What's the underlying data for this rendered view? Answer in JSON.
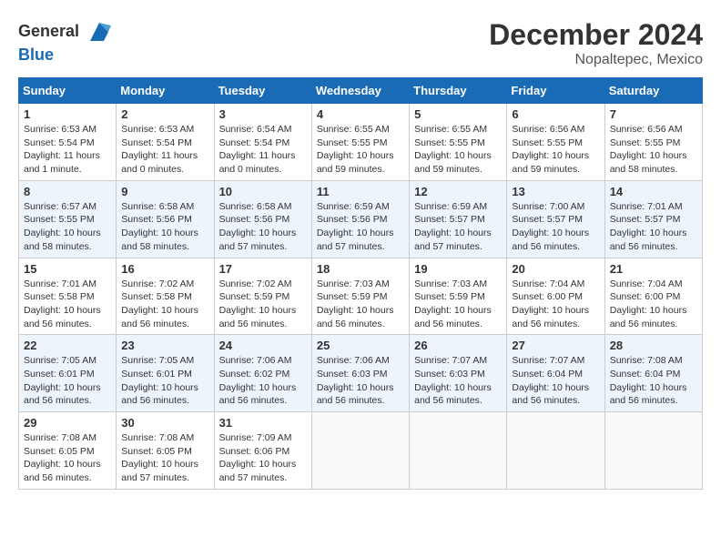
{
  "header": {
    "logo_line1": "General",
    "logo_line2": "Blue",
    "month": "December 2024",
    "location": "Nopaltepec, Mexico"
  },
  "days_of_week": [
    "Sunday",
    "Monday",
    "Tuesday",
    "Wednesday",
    "Thursday",
    "Friday",
    "Saturday"
  ],
  "weeks": [
    [
      {
        "day": "1",
        "sunrise": "6:53 AM",
        "sunset": "5:54 PM",
        "daylight": "11 hours and 1 minute."
      },
      {
        "day": "2",
        "sunrise": "6:53 AM",
        "sunset": "5:54 PM",
        "daylight": "11 hours and 0 minutes."
      },
      {
        "day": "3",
        "sunrise": "6:54 AM",
        "sunset": "5:54 PM",
        "daylight": "11 hours and 0 minutes."
      },
      {
        "day": "4",
        "sunrise": "6:55 AM",
        "sunset": "5:55 PM",
        "daylight": "10 hours and 59 minutes."
      },
      {
        "day": "5",
        "sunrise": "6:55 AM",
        "sunset": "5:55 PM",
        "daylight": "10 hours and 59 minutes."
      },
      {
        "day": "6",
        "sunrise": "6:56 AM",
        "sunset": "5:55 PM",
        "daylight": "10 hours and 59 minutes."
      },
      {
        "day": "7",
        "sunrise": "6:56 AM",
        "sunset": "5:55 PM",
        "daylight": "10 hours and 58 minutes."
      }
    ],
    [
      {
        "day": "8",
        "sunrise": "6:57 AM",
        "sunset": "5:55 PM",
        "daylight": "10 hours and 58 minutes."
      },
      {
        "day": "9",
        "sunrise": "6:58 AM",
        "sunset": "5:56 PM",
        "daylight": "10 hours and 58 minutes."
      },
      {
        "day": "10",
        "sunrise": "6:58 AM",
        "sunset": "5:56 PM",
        "daylight": "10 hours and 57 minutes."
      },
      {
        "day": "11",
        "sunrise": "6:59 AM",
        "sunset": "5:56 PM",
        "daylight": "10 hours and 57 minutes."
      },
      {
        "day": "12",
        "sunrise": "6:59 AM",
        "sunset": "5:57 PM",
        "daylight": "10 hours and 57 minutes."
      },
      {
        "day": "13",
        "sunrise": "7:00 AM",
        "sunset": "5:57 PM",
        "daylight": "10 hours and 56 minutes."
      },
      {
        "day": "14",
        "sunrise": "7:01 AM",
        "sunset": "5:57 PM",
        "daylight": "10 hours and 56 minutes."
      }
    ],
    [
      {
        "day": "15",
        "sunrise": "7:01 AM",
        "sunset": "5:58 PM",
        "daylight": "10 hours and 56 minutes."
      },
      {
        "day": "16",
        "sunrise": "7:02 AM",
        "sunset": "5:58 PM",
        "daylight": "10 hours and 56 minutes."
      },
      {
        "day": "17",
        "sunrise": "7:02 AM",
        "sunset": "5:59 PM",
        "daylight": "10 hours and 56 minutes."
      },
      {
        "day": "18",
        "sunrise": "7:03 AM",
        "sunset": "5:59 PM",
        "daylight": "10 hours and 56 minutes."
      },
      {
        "day": "19",
        "sunrise": "7:03 AM",
        "sunset": "5:59 PM",
        "daylight": "10 hours and 56 minutes."
      },
      {
        "day": "20",
        "sunrise": "7:04 AM",
        "sunset": "6:00 PM",
        "daylight": "10 hours and 56 minutes."
      },
      {
        "day": "21",
        "sunrise": "7:04 AM",
        "sunset": "6:00 PM",
        "daylight": "10 hours and 56 minutes."
      }
    ],
    [
      {
        "day": "22",
        "sunrise": "7:05 AM",
        "sunset": "6:01 PM",
        "daylight": "10 hours and 56 minutes."
      },
      {
        "day": "23",
        "sunrise": "7:05 AM",
        "sunset": "6:01 PM",
        "daylight": "10 hours and 56 minutes."
      },
      {
        "day": "24",
        "sunrise": "7:06 AM",
        "sunset": "6:02 PM",
        "daylight": "10 hours and 56 minutes."
      },
      {
        "day": "25",
        "sunrise": "7:06 AM",
        "sunset": "6:03 PM",
        "daylight": "10 hours and 56 minutes."
      },
      {
        "day": "26",
        "sunrise": "7:07 AM",
        "sunset": "6:03 PM",
        "daylight": "10 hours and 56 minutes."
      },
      {
        "day": "27",
        "sunrise": "7:07 AM",
        "sunset": "6:04 PM",
        "daylight": "10 hours and 56 minutes."
      },
      {
        "day": "28",
        "sunrise": "7:08 AM",
        "sunset": "6:04 PM",
        "daylight": "10 hours and 56 minutes."
      }
    ],
    [
      {
        "day": "29",
        "sunrise": "7:08 AM",
        "sunset": "6:05 PM",
        "daylight": "10 hours and 56 minutes."
      },
      {
        "day": "30",
        "sunrise": "7:08 AM",
        "sunset": "6:05 PM",
        "daylight": "10 hours and 57 minutes."
      },
      {
        "day": "31",
        "sunrise": "7:09 AM",
        "sunset": "6:06 PM",
        "daylight": "10 hours and 57 minutes."
      },
      null,
      null,
      null,
      null
    ]
  ],
  "labels": {
    "sunrise": "Sunrise:",
    "sunset": "Sunset:",
    "daylight": "Daylight hours"
  }
}
